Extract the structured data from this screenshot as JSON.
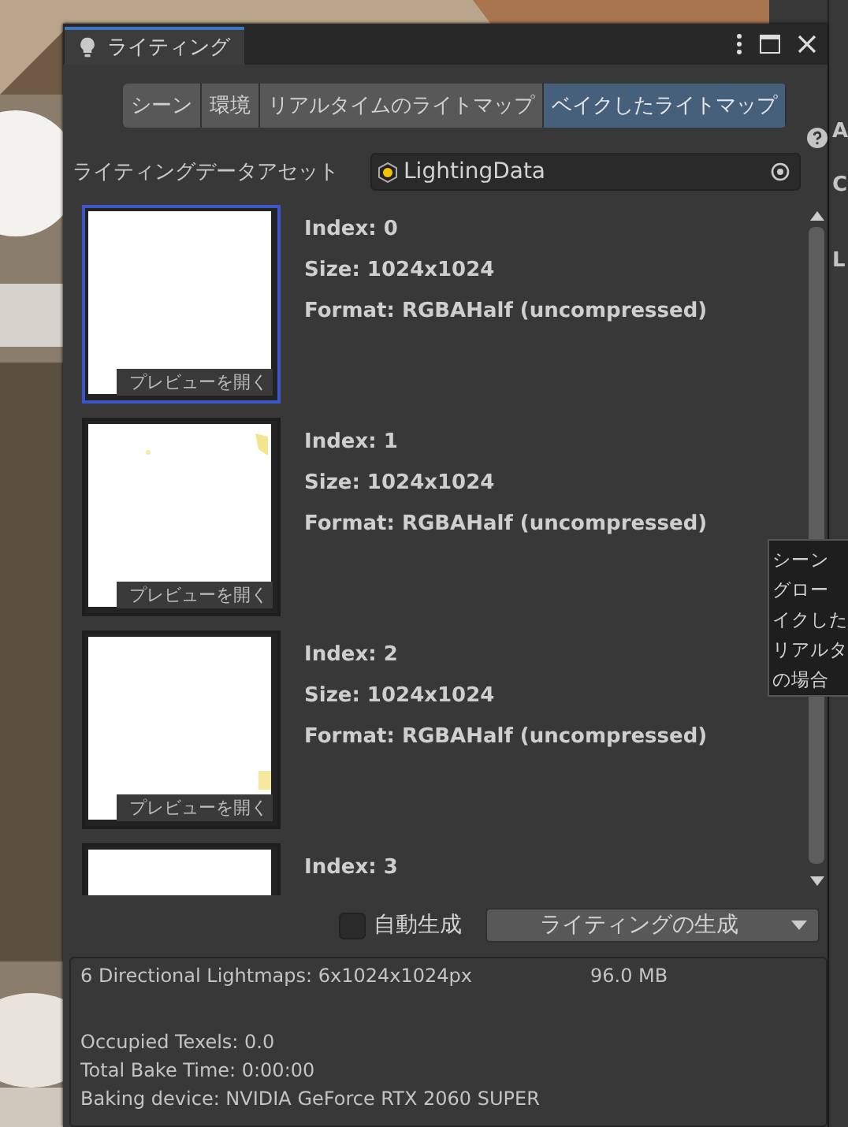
{
  "window": {
    "title": "ライティング"
  },
  "tabs": [
    {
      "label": "シーン",
      "selected": false
    },
    {
      "label": "環境",
      "selected": false
    },
    {
      "label": "リアルタイムのライトマップ",
      "selected": false
    },
    {
      "label": "ベイクしたライトマップ",
      "selected": true
    }
  ],
  "asset_field": {
    "label": "ライティングデータアセット",
    "value": "LightingData"
  },
  "lightmaps": [
    {
      "index": "Index: 0",
      "size": "Size: 1024x1024",
      "format": "Format: RGBAHalf (uncompressed)",
      "preview_button": "プレビューを開く",
      "selected": true
    },
    {
      "index": "Index: 1",
      "size": "Size: 1024x1024",
      "format": "Format: RGBAHalf (uncompressed)",
      "preview_button": "プレビューを開く",
      "selected": false
    },
    {
      "index": "Index: 2",
      "size": "Size: 1024x1024",
      "format": "Format: RGBAHalf (uncompressed)",
      "preview_button": "プレビューを開く",
      "selected": false
    },
    {
      "index": "Index: 3",
      "selected": false
    }
  ],
  "auto_generate": {
    "label": "自動生成",
    "checked": false
  },
  "generate_button": {
    "label": "ライティングの生成"
  },
  "stats": {
    "lightmaps": "6 Directional Lightmaps: 6x1024x1024px",
    "memory": "96.0 MB",
    "lines": [
      "Occupied Texels: 0.0",
      "Total Bake Time: 0:00:00",
      "Baking device: NVIDIA GeForce RTX 2060 SUPER"
    ]
  },
  "tooltip": {
    "lines": [
      "シーン",
      "グロー",
      "イクした",
      "リアルタ",
      "の場合"
    ]
  },
  "inspector": {
    "fragments": [
      {
        "text": "A"
      },
      {
        "text": "C"
      },
      {
        "text": "L"
      }
    ]
  }
}
